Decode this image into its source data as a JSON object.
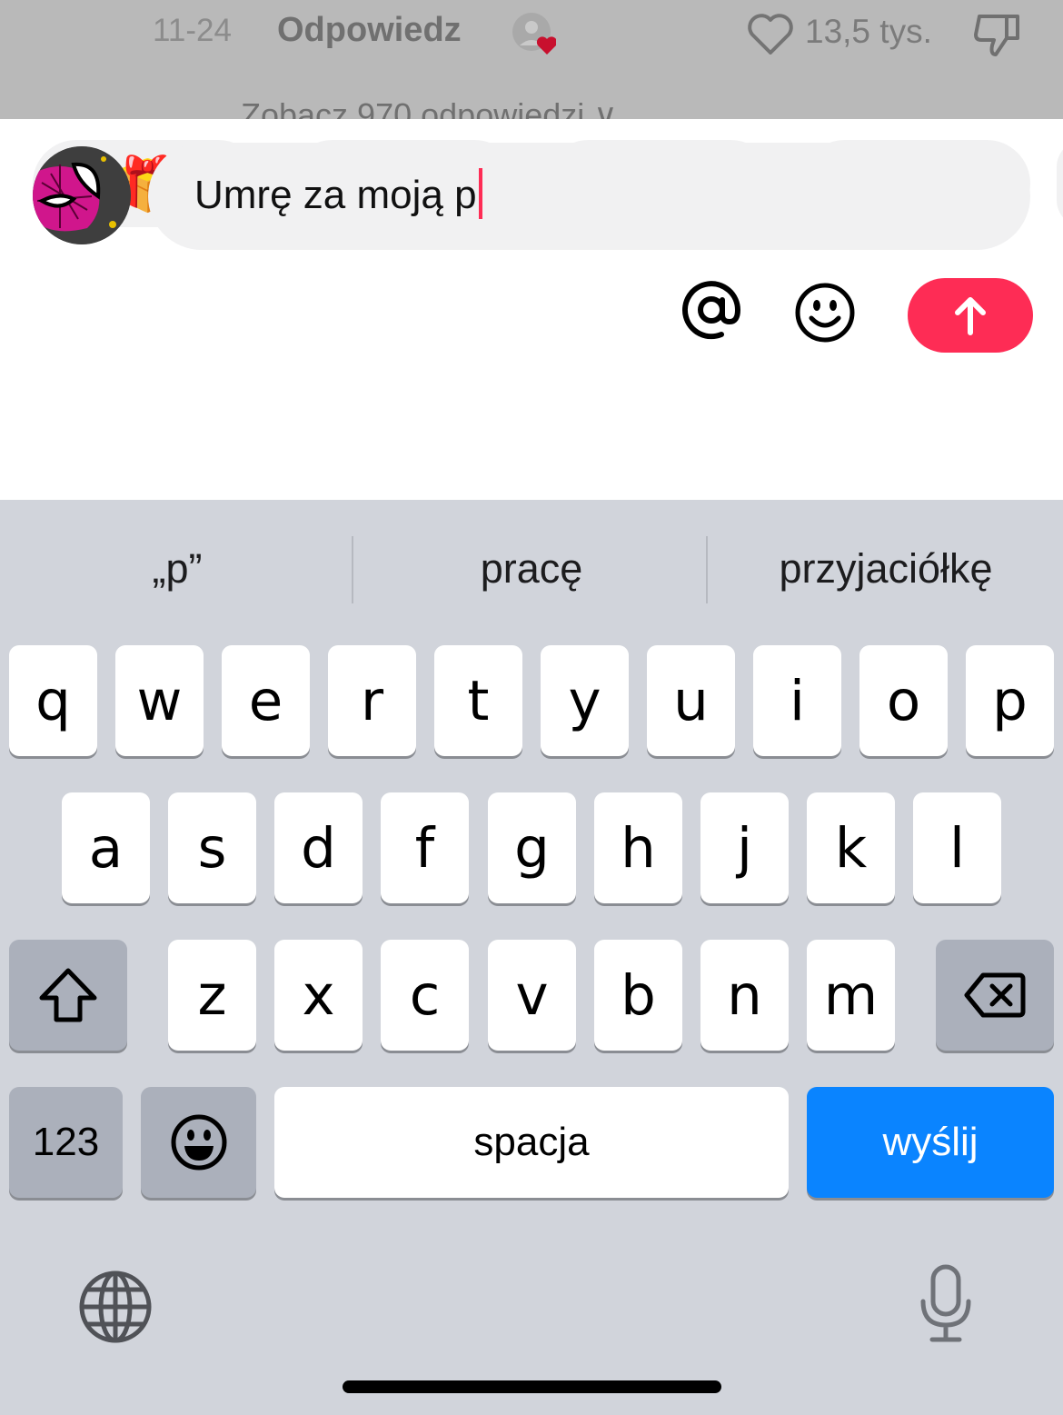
{
  "comment": {
    "date": "11-24",
    "reply_label": "Odpowiedz",
    "likes": "13,5 tys.",
    "more_replies": "Zobacz 970 odpowiedzi ∨"
  },
  "quick_emoji": [
    "🎁🎁🎁",
    "🎄🎄🎄",
    "🎅🎅🎅",
    "🥰🥰🥰"
  ],
  "composer": {
    "text": "Umrę za moją p"
  },
  "colors": {
    "accent": "#fe2c55",
    "send_key": "#0a84ff"
  },
  "keyboard": {
    "suggestions": [
      "„p”",
      "pracę",
      "przyjaciółkę"
    ],
    "row1": [
      "q",
      "w",
      "e",
      "r",
      "t",
      "y",
      "u",
      "i",
      "o",
      "p"
    ],
    "row2": [
      "a",
      "s",
      "d",
      "f",
      "g",
      "h",
      "j",
      "k",
      "l"
    ],
    "row3": [
      "z",
      "x",
      "c",
      "v",
      "b",
      "n",
      "m"
    ],
    "numbers_label": "123",
    "space_label": "spacja",
    "return_label": "wyślij"
  }
}
